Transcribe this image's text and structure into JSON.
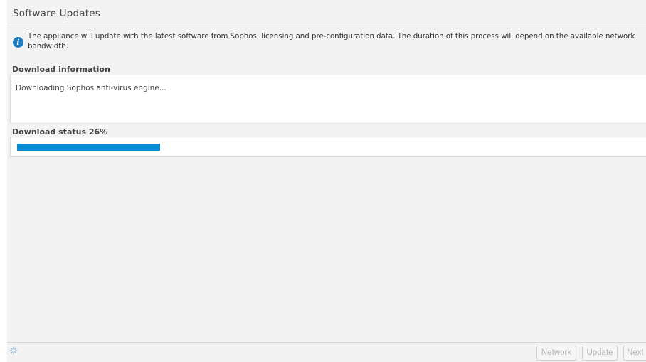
{
  "window": {
    "title": "Software Updates"
  },
  "info": {
    "icon": "info-icon",
    "text": "The appliance will update with the latest software from Sophos, licensing and pre-configuration data. The duration of this process will depend on the available network bandwidth."
  },
  "download_info": {
    "label": "Download information",
    "text": "Downloading Sophos anti-virus engine..."
  },
  "download_status": {
    "label": "Download status 26%",
    "progress_percent": 26,
    "bar_color": "#0a8ad0"
  },
  "footer": {
    "spinner_icon": "loading-spinner-icon",
    "buttons": {
      "network": "Network",
      "update": "Update",
      "next": "Next"
    }
  },
  "colors": {
    "accent": "#1a7dc4",
    "background": "#f3f3f3"
  }
}
